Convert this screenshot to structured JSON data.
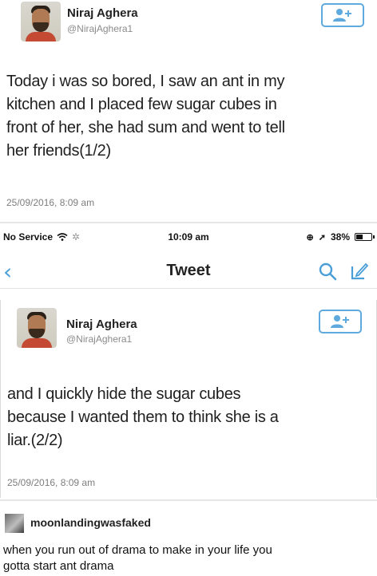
{
  "tweet1": {
    "name": "Niraj Aghera",
    "handle": "@NirajAghera1",
    "text_lines": [
      "Today i was so bored, I saw an ant in my",
      "kitchen and I placed few sugar cubes in",
      "front of her, she had sum and went to tell",
      "her friends(1/2)"
    ],
    "date": "25/09/2016, 8:09 am"
  },
  "statusbar": {
    "carrier": "No Service",
    "time": "10:09 am",
    "battery": "38%",
    "battery_level": 0.38
  },
  "navbar": {
    "title": "Tweet",
    "back_icon": "chevron-left-icon",
    "search_icon": "search-icon",
    "compose_icon": "compose-icon"
  },
  "tweet2": {
    "name": "Niraj Aghera",
    "handle": "@NirajAghera1",
    "text_lines": [
      "and I quickly hide the sugar cubes",
      "because I wanted them to think she is a",
      "liar.(2/2)"
    ],
    "date": "25/09/2016, 8:09 am"
  },
  "post": {
    "username": "moonlandingwasfaked",
    "text_lines": [
      "when you run out of drama to make in your life you",
      "gotta start ant drama"
    ]
  },
  "colors": {
    "accent": "#5ea9dd",
    "back": "#4a9fd8"
  }
}
